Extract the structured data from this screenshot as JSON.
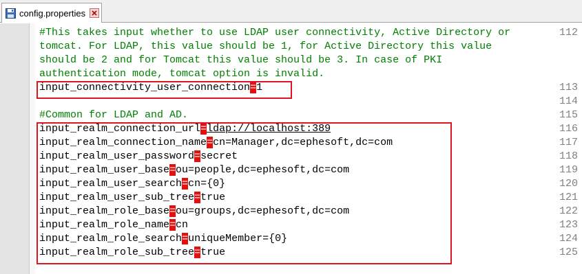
{
  "tab": {
    "filename": "config.properties",
    "icon": "save-disk-icon",
    "close_icon": "close-icon"
  },
  "colors": {
    "comment": "#008000",
    "highlight_box": "#e0141e",
    "equals_marker": "#e41010",
    "line_numbers": "#808080"
  },
  "lines": [
    {
      "num": "112",
      "type": "comment",
      "text": "#This takes input whether to use LDAP user connectivity, Active Directory or"
    },
    {
      "num": "",
      "type": "comment",
      "text": "tomcat. For LDAP, this value should be 1, for Active Directory this value"
    },
    {
      "num": "",
      "type": "comment",
      "text": "should be 2 and for Tomcat this value should be 3. In case of PKI"
    },
    {
      "num": "",
      "type": "comment",
      "text": "authentication mode, tomcat option is invalid."
    },
    {
      "num": "113",
      "type": "kv",
      "key": "input_connectivity_user_connection",
      "eq": "=",
      "value": "1"
    },
    {
      "num": "114",
      "type": "blank",
      "text": ""
    },
    {
      "num": "115",
      "type": "comment",
      "text": "#Common for LDAP and AD."
    },
    {
      "num": "116",
      "type": "kv",
      "key": "input_realm_connection_url",
      "eq": "=",
      "value": "ldap://localhost:389",
      "link": true
    },
    {
      "num": "117",
      "type": "kv",
      "key": "input_realm_connection_name",
      "eq": "=",
      "value": "cn=Manager,dc=ephesoft,dc=com"
    },
    {
      "num": "118",
      "type": "kv",
      "key": "input_realm_user_password",
      "eq": "=",
      "value": "secret"
    },
    {
      "num": "119",
      "type": "kv",
      "key": "input_realm_user_base",
      "eq": "=",
      "value": "ou=people,dc=ephesoft,dc=com"
    },
    {
      "num": "120",
      "type": "kv",
      "key": "input_realm_user_search",
      "eq": "=",
      "value": "cn={0}"
    },
    {
      "num": "121",
      "type": "kv",
      "key": "input_realm_user_sub_tree",
      "eq": "=",
      "value": "true"
    },
    {
      "num": "122",
      "type": "kv",
      "key": "input_realm_role_base",
      "eq": "=",
      "value": "ou=groups,dc=ephesoft,dc=com"
    },
    {
      "num": "123",
      "type": "kv",
      "key": "input_realm_role_name",
      "eq": "=",
      "value": "cn"
    },
    {
      "num": "124",
      "type": "kv",
      "key": "input_realm_role_search",
      "eq": "=",
      "value": "uniqueMember={0}"
    },
    {
      "num": "125",
      "type": "kv",
      "key": "input_realm_role_sub_tree",
      "eq": "=",
      "value": "true"
    },
    {
      "num": "",
      "type": "blank",
      "text": ""
    }
  ]
}
